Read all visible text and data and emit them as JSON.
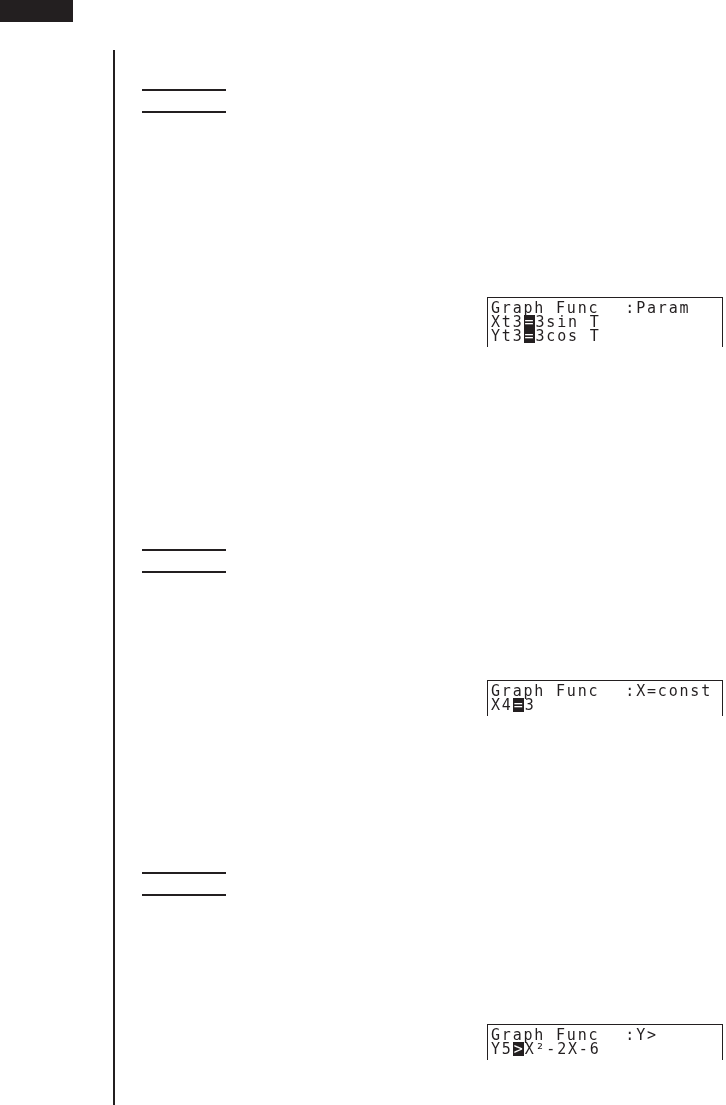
{
  "sections": [
    {
      "screen": {
        "title": "Graph Func",
        "mode": ":Param",
        "lines": [
          {
            "name": "Xt3",
            "sign": "=",
            "selected": true,
            "expression": "3sin T"
          },
          {
            "name": "Yt3",
            "sign": "=",
            "selected": true,
            "expression": "3cos T"
          }
        ]
      }
    },
    {
      "screen": {
        "title": "Graph Func",
        "mode": ":X=const",
        "lines": [
          {
            "name": "X4",
            "sign": "=",
            "selected": true,
            "expression": "3"
          }
        ]
      }
    },
    {
      "screen": {
        "title": "Graph Func",
        "mode": ":Y>",
        "lines": [
          {
            "name": "Y5",
            "sign": ">",
            "selected": true,
            "expression": "X²-2X-6"
          }
        ]
      }
    }
  ]
}
